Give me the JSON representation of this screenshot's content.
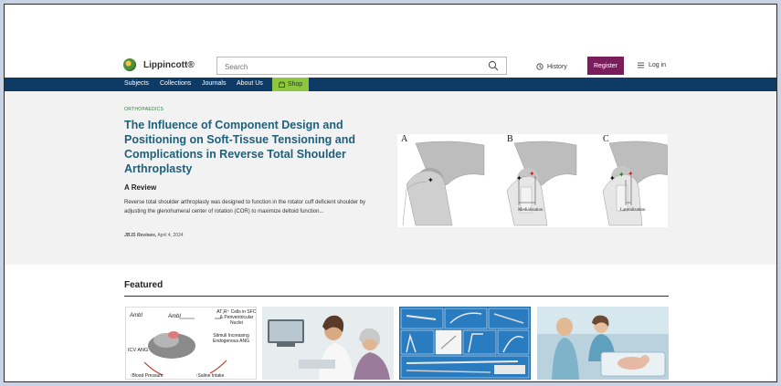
{
  "header": {
    "logo_text": "Lippincott®",
    "search_placeholder": "Search",
    "history_label": "History",
    "register_label": "Register",
    "login_label": "Log in"
  },
  "nav": {
    "items": [
      "Subjects",
      "Collections",
      "Journals",
      "About Us"
    ],
    "shop_label": "Shop"
  },
  "hero": {
    "category": "ORTHOPAEDICS",
    "title": "The Influence of Component Design and Positioning on Soft-Tissue Tensioning and Complications in Reverse Total Shoulder Arthroplasty",
    "subtitle": "A Review",
    "description": "Reverse total shoulder arthroplasty was designed to function in the rotator cuff deficient shoulder by adjusting the glenohumeral center of rotation (COR) to maximize deltoid function...",
    "journal": "JBJS Reviews,",
    "date": "April 4, 2024",
    "figure": {
      "panels": [
        "A",
        "B",
        "C"
      ],
      "captions": [
        "Medialisation",
        "Lateralisation"
      ]
    }
  },
  "featured": {
    "title": "Featured",
    "card1": {
      "formula": "AmbI",
      "label_top": "AT₁R⁺ Cells in SFO & Periventricular Nuclei",
      "label_mid": "Stimuli Increasing Endogenous ANG",
      "label_left": "ICV ANG",
      "label_bottom_left": "↑Blood Pressure",
      "label_bottom_right": "↑Saline Intake"
    }
  },
  "colors": {
    "nav_bg": "#0d3b66",
    "register_bg": "#7a1d5c",
    "shop_bg": "#8ec63f",
    "title_color": "#1f5f7a",
    "hero_bg": "#f2f2f2"
  }
}
